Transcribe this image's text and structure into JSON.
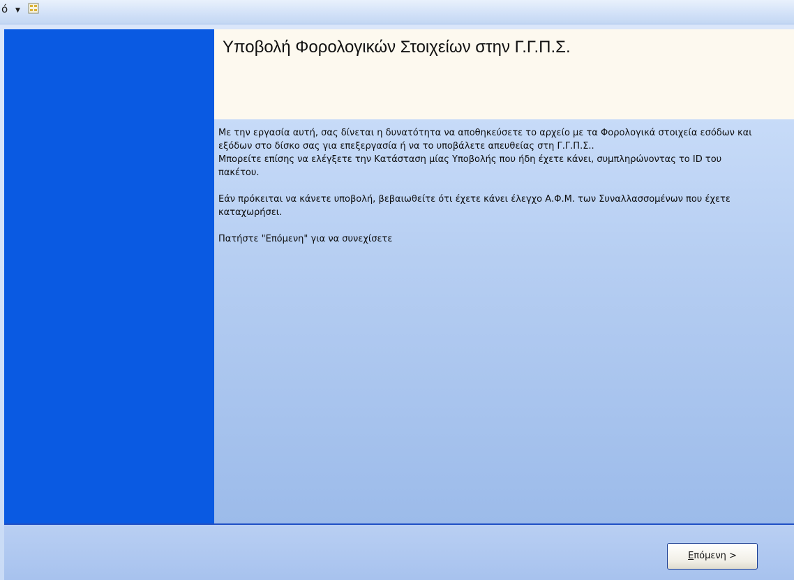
{
  "toolbar": {
    "left_glyph": "ó",
    "dropdown_glyph": "▼"
  },
  "wizard": {
    "title": "Υποβολή Φορολογικών Στοιχείων στην Γ.Γ.Π.Σ.",
    "paragraphs": [
      "Με την εργασία αυτή, σας δίνεται η δυνατότητα να αποθηκεύσετε το αρχείο με τα Φορολογικά στοιχεία εσόδων και εξόδων στο δίσκο σας για επεξεργασία ή να το υποβάλετε απευθείας στη Γ.Γ.Π.Σ..",
      "Μπορείτε επίσης να ελέγξετε την Κατάσταση μίας Υποβολής που ήδη έχετε κάνει, συμπληρώνοντας το ID του πακέτου.",
      "Εάν πρόκειται να κάνετε υποβολή, βεβαιωθείτε ότι έχετε κάνει έλεγχο Α.Φ.Μ. των Συναλλασσομένων που έχετε καταχωρήσει.",
      "Πατήστε \"Επόμενη\" για να συνεχίσετε"
    ],
    "next_button": {
      "accel": "Ε",
      "rest": "πόμενη >"
    }
  },
  "colors": {
    "left_panel": "#0a5ae2",
    "header_bg": "#fdf9ef",
    "content_top": "#c7dbf8",
    "content_bottom": "#9cbbea"
  }
}
